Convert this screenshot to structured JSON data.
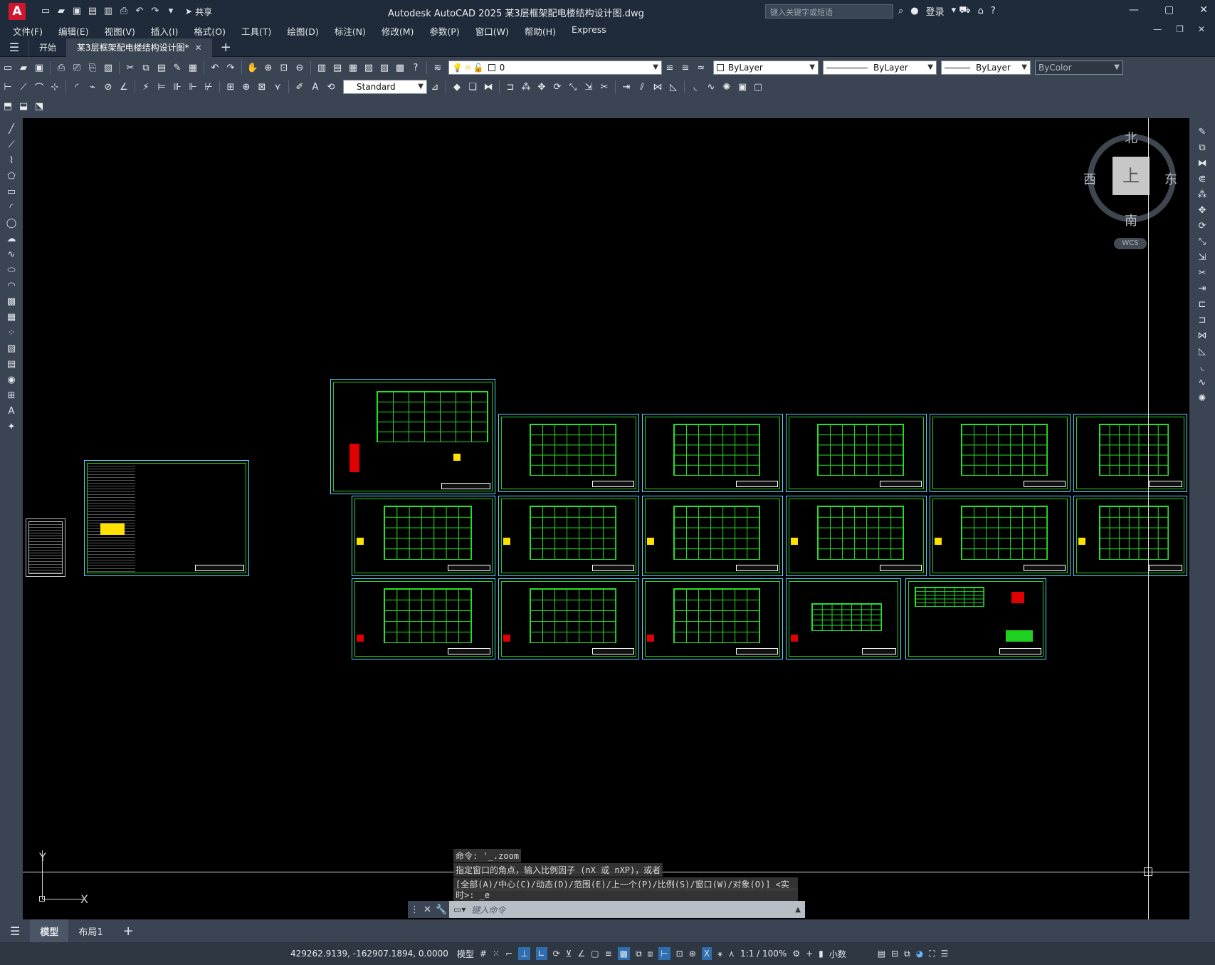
{
  "app": {
    "logo": "A",
    "title": "Autodesk AutoCAD 2025    某3层框架配电楼结构设计图.dwg",
    "share": "共享"
  },
  "search": {
    "placeholder": "键入关键字或短语"
  },
  "user": {
    "login": "登录"
  },
  "menu": [
    "文件(F)",
    "编辑(E)",
    "视图(V)",
    "插入(I)",
    "格式(O)",
    "工具(T)",
    "绘图(D)",
    "标注(N)",
    "修改(M)",
    "参数(P)",
    "窗口(W)",
    "帮助(H)",
    "Express"
  ],
  "tabs": [
    {
      "label": "开始"
    },
    {
      "label": "某3层框架配电楼结构设计图*"
    }
  ],
  "toolbar": {
    "layer": "0",
    "textstyle": "Standard",
    "color": "ByLayer",
    "linetype": "ByLayer",
    "lineweight": "ByLayer",
    "plotstyle": "ByColor"
  },
  "viewcube": {
    "north": "北",
    "south": "南",
    "east": "东",
    "west": "西",
    "face": "上",
    "wcs": "WCS"
  },
  "ucs": {
    "x": "X",
    "y": "Y"
  },
  "command": {
    "h1": "命令: '_.zoom",
    "h2": "指定窗口的角点，输入比例因子 (nX 或 nXP)，或者",
    "h3": "[全部(A)/中心(C)/动态(D)/范围(E)/上一个(P)/比例(S)/窗口(W)/对象(O)] <实",
    "h4": "时>: _e",
    "placeholder": "键入命令"
  },
  "layouts": [
    {
      "label": "模型"
    },
    {
      "label": "布局1"
    }
  ],
  "status": {
    "coords": "429262.9139, -162907.1894, 0.0000",
    "model": "模型",
    "scale": "1:1 / 100%",
    "units": "小数"
  }
}
